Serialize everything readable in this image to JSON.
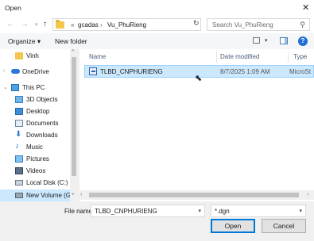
{
  "window": {
    "title": "Open"
  },
  "address": {
    "prefix": "«",
    "crumbs": [
      "gcadas",
      "Vu_PhuRieng"
    ],
    "separator": "›",
    "search_placeholder": "Search Vu_PhuRieng"
  },
  "toolbar": {
    "organize_label": "Organize ▾",
    "new_folder_label": "New folder"
  },
  "nav": {
    "items": [
      {
        "label": "Vinh",
        "icon": "folder-icon"
      },
      {
        "label": "OneDrive",
        "icon": "cloud-icon"
      },
      {
        "label": "This PC",
        "icon": "computer-icon"
      },
      {
        "label": "3D Objects",
        "icon": "cube-icon"
      },
      {
        "label": "Desktop",
        "icon": "desktop-icon"
      },
      {
        "label": "Documents",
        "icon": "documents-icon"
      },
      {
        "label": "Downloads",
        "icon": "download-icon"
      },
      {
        "label": "Music",
        "icon": "music-icon"
      },
      {
        "label": "Pictures",
        "icon": "pictures-icon"
      },
      {
        "label": "Videos",
        "icon": "videos-icon"
      },
      {
        "label": "Local Disk (C:)",
        "icon": "drive-icon"
      },
      {
        "label": "New Volume (G:)",
        "icon": "drive-icon"
      }
    ]
  },
  "files": {
    "columns": [
      "Name",
      "Date modified",
      "Type"
    ],
    "rows": [
      {
        "name": "TLBD_CNPHURIENG",
        "date": "8/7/2025 1:09 AM",
        "type": "MicroSt"
      }
    ]
  },
  "bottom": {
    "filename_label": "File name:",
    "filename_value": "TLBD_CNPHURIENG",
    "filetype_value": "*.dgn",
    "open_label": "Open",
    "cancel_label": "Cancel"
  },
  "colors": {
    "selection": "#cce8ff",
    "accent": "#0078d7",
    "folder": "#f3c74c"
  }
}
